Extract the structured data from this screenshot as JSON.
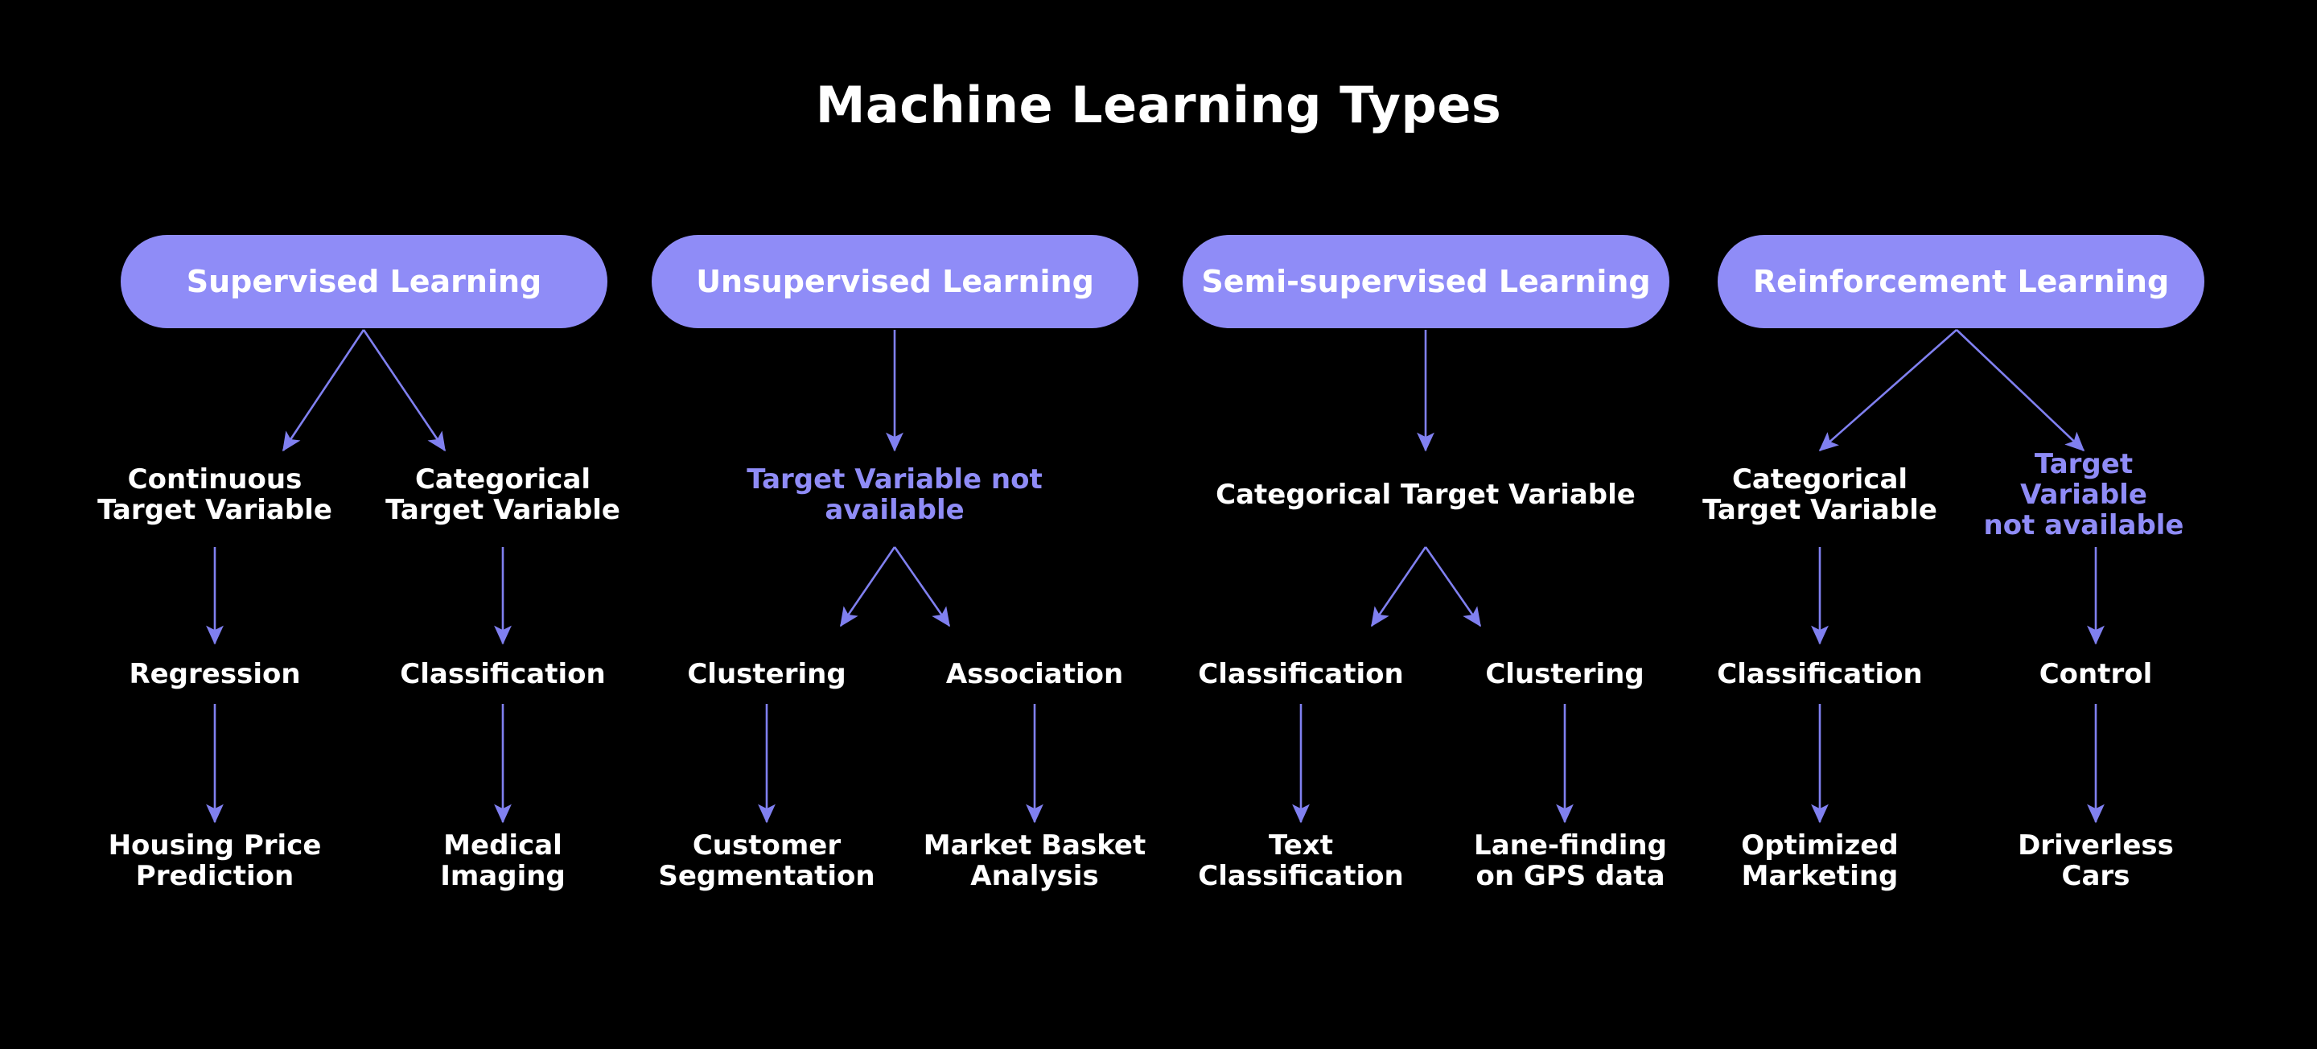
{
  "page": {
    "title": "Machine Learning Types",
    "background_color": "#000000",
    "accent_color": "#8f8cf7",
    "text_color": "#ffffff",
    "arrow_color": "#8080f0"
  },
  "columns": [
    {
      "id": "supervised",
      "pill_label": "Supervised Learning",
      "branches": [
        {
          "target_label": "Continuous\nTarget Variable",
          "target_style": "white",
          "task_label": "Regression",
          "example_label": "Housing Price\nPrediction"
        },
        {
          "target_label": "Categorical\nTarget Variable",
          "target_style": "white",
          "task_label": "Classification",
          "example_label": "Medical\nImaging"
        }
      ]
    },
    {
      "id": "unsupervised",
      "pill_label": "Unsupervised Learning",
      "target_label": "Target Variable not\navailable",
      "target_style": "accent",
      "branches": [
        {
          "task_label": "Clustering",
          "example_label": "Customer\nSegmentation"
        },
        {
          "task_label": "Association",
          "example_label": "Market Basket\nAnalysis"
        }
      ]
    },
    {
      "id": "semi-supervised",
      "pill_label": "Semi-supervised Learning",
      "target_label": "Categorical Target Variable",
      "target_style": "white",
      "branches": [
        {
          "task_label": "Classification",
          "example_label": "Text\nClassification"
        },
        {
          "task_label": "Clustering",
          "example_label": "Lane-finding\non GPS data"
        }
      ]
    },
    {
      "id": "reinforcement",
      "pill_label": "Reinforcement Learning",
      "branches": [
        {
          "target_label": "Categorical\nTarget Variable",
          "target_style": "white",
          "task_label": "Classification",
          "example_label": "Optimized\nMarketing"
        },
        {
          "target_label": "Target Variable\nnot available",
          "target_style": "accent",
          "task_label": "Control",
          "example_label": "Driverless\nCars"
        }
      ]
    }
  ]
}
